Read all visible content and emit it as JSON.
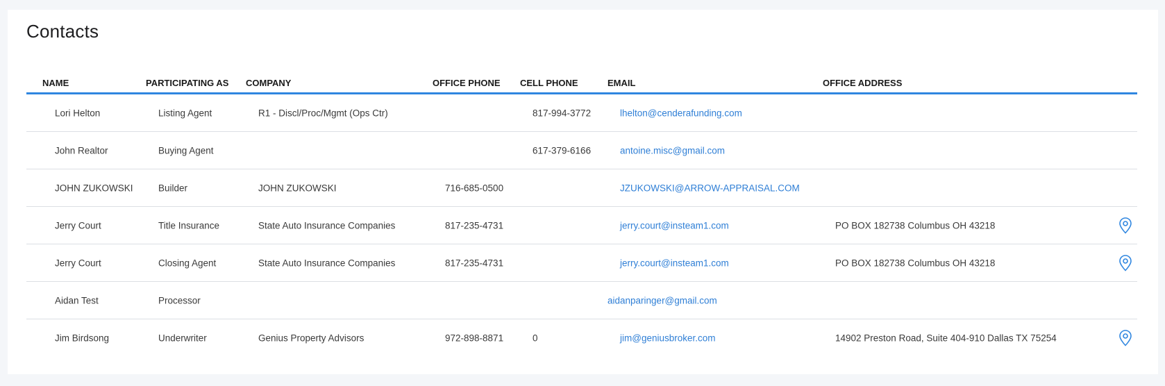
{
  "page": {
    "title": "Contacts"
  },
  "columns": {
    "name": "NAME",
    "role": "PARTICIPATING AS",
    "company": "COMPANY",
    "office_phone": "OFFICE PHONE",
    "cell_phone": "CELL PHONE",
    "email": "EMAIL",
    "office_address": "OFFICE ADDRESS"
  },
  "rows": [
    {
      "name": "Lori Helton",
      "role": "Listing Agent",
      "company": "R1 - Discl/Proc/Mgmt (Ops Ctr)",
      "office_phone": "",
      "cell_phone": "817-994-3772",
      "email": "lhelton@cenderafunding.com",
      "office_address": "",
      "has_map": false
    },
    {
      "name": "John Realtor",
      "role": "Buying Agent",
      "company": "",
      "office_phone": "",
      "cell_phone": "617-379-6166",
      "email": "antoine.misc@gmail.com",
      "office_address": "",
      "has_map": false
    },
    {
      "name": "JOHN ZUKOWSKI",
      "role": "Builder",
      "company": "JOHN ZUKOWSKI",
      "office_phone": "716-685-0500",
      "cell_phone": "",
      "email": "JZUKOWSKI@ARROW-APPRAISAL.COM",
      "office_address": "",
      "has_map": false
    },
    {
      "name": "Jerry Court",
      "role": "Title Insurance",
      "company": "State Auto Insurance Companies",
      "office_phone": "817-235-4731",
      "cell_phone": "",
      "email": "jerry.court@insteam1.com",
      "office_address": "PO BOX 182738 Columbus OH 43218",
      "has_map": true
    },
    {
      "name": "Jerry Court",
      "role": "Closing Agent",
      "company": "State Auto Insurance Companies",
      "office_phone": "817-235-4731",
      "cell_phone": "",
      "email": "jerry.court@insteam1.com",
      "office_address": "PO BOX 182738 Columbus OH 43218",
      "has_map": true
    },
    {
      "name": "Aidan Test",
      "role": "Processor",
      "company": "",
      "office_phone": "",
      "cell_phone": "",
      "email": "aidanparinger@gmail.com",
      "office_address": "",
      "has_map": false
    },
    {
      "name": "Jim Birdsong",
      "role": "Underwriter",
      "company": "Genius Property Advisors",
      "office_phone": "972-898-8871",
      "cell_phone": "0",
      "email": "jim@geniusbroker.com",
      "office_address": "14902 Preston Road, Suite 404-910 Dallas TX 75254",
      "has_map": true
    }
  ],
  "icons": {
    "map": "map-pin-icon"
  },
  "colors": {
    "accent": "#2f86e0",
    "link": "#2f7fd6",
    "divider": "#dcdfe4"
  }
}
